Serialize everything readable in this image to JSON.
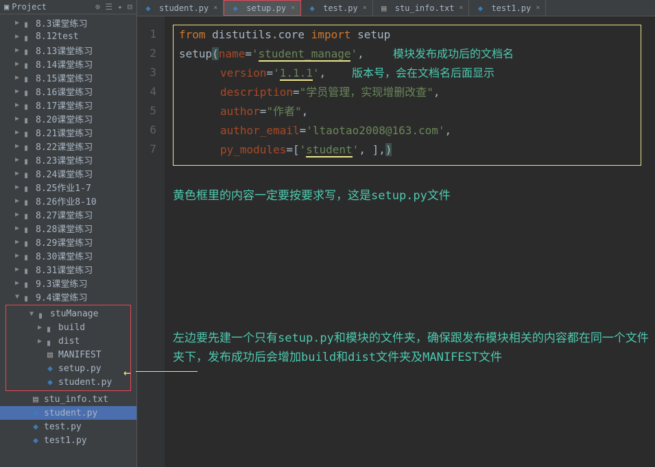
{
  "project": {
    "title": "Project",
    "tree": [
      {
        "label": "8.3课堂练习",
        "level": 1,
        "type": "folder",
        "open": false
      },
      {
        "label": "8.12test",
        "level": 1,
        "type": "folder",
        "open": false
      },
      {
        "label": "8.13课堂练习",
        "level": 1,
        "type": "folder",
        "open": false
      },
      {
        "label": "8.14课堂练习",
        "level": 1,
        "type": "folder",
        "open": false
      },
      {
        "label": "8.15课堂练习",
        "level": 1,
        "type": "folder",
        "open": false
      },
      {
        "label": "8.16课堂练习",
        "level": 1,
        "type": "folder",
        "open": false
      },
      {
        "label": "8.17课堂练习",
        "level": 1,
        "type": "folder",
        "open": false
      },
      {
        "label": "8.20课堂练习",
        "level": 1,
        "type": "folder",
        "open": false
      },
      {
        "label": "8.21课堂练习",
        "level": 1,
        "type": "folder",
        "open": false
      },
      {
        "label": "8.22课堂练习",
        "level": 1,
        "type": "folder",
        "open": false
      },
      {
        "label": "8.23课堂练习",
        "level": 1,
        "type": "folder",
        "open": false
      },
      {
        "label": "8.24课堂练习",
        "level": 1,
        "type": "folder",
        "open": false
      },
      {
        "label": "8.25作业1-7",
        "level": 1,
        "type": "folder",
        "open": false
      },
      {
        "label": "8.26作业8-10",
        "level": 1,
        "type": "folder",
        "open": false
      },
      {
        "label": "8.27课堂练习",
        "level": 1,
        "type": "folder",
        "open": false
      },
      {
        "label": "8.28课堂练习",
        "level": 1,
        "type": "folder",
        "open": false
      },
      {
        "label": "8.29课堂练习",
        "level": 1,
        "type": "folder",
        "open": false
      },
      {
        "label": "8.30课堂练习",
        "level": 1,
        "type": "folder",
        "open": false
      },
      {
        "label": "8.31课堂练习",
        "level": 1,
        "type": "folder",
        "open": false
      },
      {
        "label": "9.3课堂练习",
        "level": 1,
        "type": "folder",
        "open": false
      },
      {
        "label": "9.4课堂练习",
        "level": 1,
        "type": "folder",
        "open": true
      }
    ],
    "stuManage": {
      "label": "stuManage",
      "children": [
        {
          "label": "build",
          "type": "folder"
        },
        {
          "label": "dist",
          "type": "folder"
        },
        {
          "label": "MANIFEST",
          "type": "txt"
        },
        {
          "label": "setup.py",
          "type": "py"
        },
        {
          "label": "student.py",
          "type": "py"
        }
      ]
    },
    "rest": [
      {
        "label": "stu_info.txt",
        "type": "txt"
      },
      {
        "label": "student.py",
        "type": "py",
        "selected": true
      },
      {
        "label": "test.py",
        "type": "py"
      },
      {
        "label": "test1.py",
        "type": "py"
      }
    ]
  },
  "tabs": [
    {
      "label": "student.py",
      "type": "py"
    },
    {
      "label": "setup.py",
      "type": "py",
      "active": true,
      "highlighted": true
    },
    {
      "label": "test.py",
      "type": "py"
    },
    {
      "label": "stu_info.txt",
      "type": "txt"
    },
    {
      "label": "test1.py",
      "type": "py"
    }
  ],
  "code": {
    "line1": {
      "from": "from",
      "mod": "distutils.core",
      "import": "import",
      "name": "setup"
    },
    "line2": {
      "fn": "setup",
      "p": "name",
      "v": "student_manage"
    },
    "line3": {
      "p": "version",
      "v": "1.1.1"
    },
    "line4": {
      "p": "description",
      "v": "学员管理，实现增删改查"
    },
    "line5": {
      "p": "author",
      "v": "作者"
    },
    "line6": {
      "p": "author_email",
      "v": "ltaotao2008@163.com"
    },
    "line7": {
      "p": "py_modules",
      "v": "student"
    }
  },
  "annotations": {
    "a1": "模块发布成功后的文档名",
    "a2": "版本号，会在文档名后面显示",
    "a3": "黄色框里的内容一定要按要求写，这是setup.py文件",
    "a4": "左边要先建一个只有setup.py和模块的文件夹，确保跟发布模块相关的内容都在同一个文件夹下，发布成功后会增加build和dist文件夹及MANIFEST文件"
  }
}
